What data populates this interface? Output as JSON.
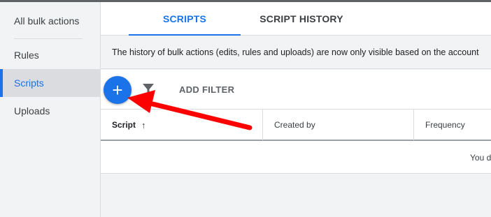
{
  "sidebar": {
    "items": [
      {
        "label": "All bulk actions",
        "active": false
      },
      {
        "label": "Rules",
        "active": false
      },
      {
        "label": "Scripts",
        "active": true
      },
      {
        "label": "Uploads",
        "active": false
      }
    ]
  },
  "tabs": [
    {
      "label": "SCRIPTS",
      "active": true
    },
    {
      "label": "SCRIPT HISTORY",
      "active": false
    }
  ],
  "notice": {
    "text": "The history of bulk actions (edits, rules and uploads) are now only visible based on the account"
  },
  "toolbar": {
    "add_icon": "plus-icon",
    "add_glyph": "+",
    "filter_icon": "filter-icon",
    "add_filter_label": "ADD FILTER"
  },
  "table": {
    "columns": [
      {
        "label": "Script",
        "sort": "ascending",
        "sort_icon": "arrow-up-icon",
        "sort_glyph": "↑"
      },
      {
        "label": "Created by"
      },
      {
        "label": "Frequency"
      }
    ],
    "empty_message": "You d"
  },
  "annotation": {
    "arrow_color": "#ff0000",
    "target": "add-script-button"
  },
  "colors": {
    "accent": "#1a73e8",
    "sidebar_bg": "#f1f3f4",
    "active_item_bg": "#dadce0",
    "text": "#3c4043"
  }
}
